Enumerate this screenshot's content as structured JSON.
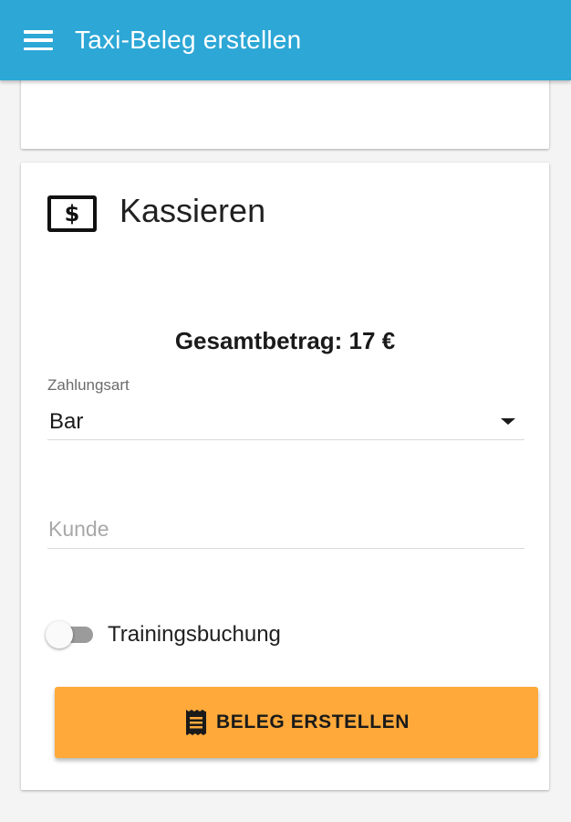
{
  "app_bar": {
    "title": "Taxi-Beleg erstellen",
    "menu_icon": "menu-icon",
    "color": "#2ca7d6"
  },
  "payment_card": {
    "icon": "money-icon",
    "icon_symbol": "$",
    "title": "Kassieren",
    "total_text": "Gesamtbetrag: 17 €",
    "payment_method": {
      "label": "Zahlungsart",
      "value": "Bar"
    },
    "customer": {
      "placeholder": "Kunde",
      "value": ""
    },
    "training_toggle": {
      "label": "Trainingsbuchung",
      "checked": false
    },
    "submit": {
      "label": "BELEG ERSTELLEN",
      "icon": "receipt-icon",
      "color": "#ffa93a"
    }
  }
}
